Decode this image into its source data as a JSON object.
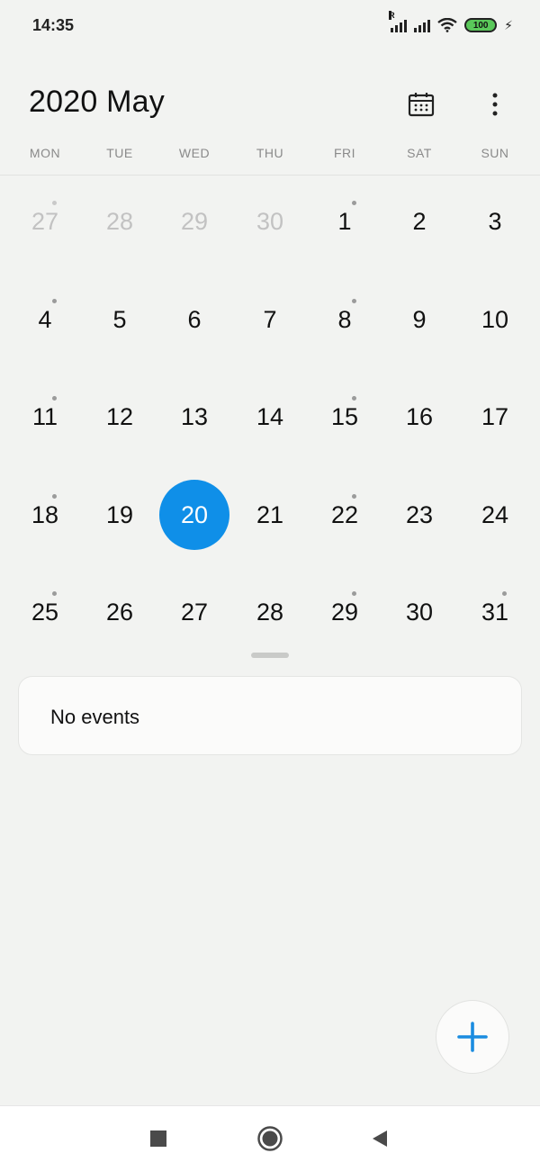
{
  "status_bar": {
    "time": "14:35",
    "battery": "100",
    "icons": [
      "signal-roaming-icon",
      "signal-icon",
      "wifi-icon",
      "battery-icon",
      "charging-icon"
    ]
  },
  "header": {
    "title": "2020 May",
    "calendar_icon": "calendar-icon",
    "more_icon": "more-vertical-icon"
  },
  "weekdays": [
    "MON",
    "TUE",
    "WED",
    "THU",
    "FRI",
    "SAT",
    "SUN"
  ],
  "weeks": [
    [
      {
        "day": "27",
        "muted": true,
        "dot": true
      },
      {
        "day": "28",
        "muted": true,
        "dot": false
      },
      {
        "day": "29",
        "muted": true,
        "dot": false
      },
      {
        "day": "30",
        "muted": true,
        "dot": false
      },
      {
        "day": "1",
        "muted": false,
        "dot": true
      },
      {
        "day": "2",
        "muted": false,
        "dot": false
      },
      {
        "day": "3",
        "muted": false,
        "dot": false
      }
    ],
    [
      {
        "day": "4",
        "muted": false,
        "dot": true
      },
      {
        "day": "5",
        "muted": false,
        "dot": false
      },
      {
        "day": "6",
        "muted": false,
        "dot": false
      },
      {
        "day": "7",
        "muted": false,
        "dot": false
      },
      {
        "day": "8",
        "muted": false,
        "dot": true
      },
      {
        "day": "9",
        "muted": false,
        "dot": false
      },
      {
        "day": "10",
        "muted": false,
        "dot": false
      }
    ],
    [
      {
        "day": "11",
        "muted": false,
        "dot": true
      },
      {
        "day": "12",
        "muted": false,
        "dot": false
      },
      {
        "day": "13",
        "muted": false,
        "dot": false
      },
      {
        "day": "14",
        "muted": false,
        "dot": false
      },
      {
        "day": "15",
        "muted": false,
        "dot": true
      },
      {
        "day": "16",
        "muted": false,
        "dot": false
      },
      {
        "day": "17",
        "muted": false,
        "dot": false
      }
    ],
    [
      {
        "day": "18",
        "muted": false,
        "dot": true
      },
      {
        "day": "19",
        "muted": false,
        "dot": false
      },
      {
        "day": "20",
        "muted": false,
        "dot": false,
        "selected": true
      },
      {
        "day": "21",
        "muted": false,
        "dot": false
      },
      {
        "day": "22",
        "muted": false,
        "dot": true
      },
      {
        "day": "23",
        "muted": false,
        "dot": false
      },
      {
        "day": "24",
        "muted": false,
        "dot": false
      }
    ],
    [
      {
        "day": "25",
        "muted": false,
        "dot": true
      },
      {
        "day": "26",
        "muted": false,
        "dot": false
      },
      {
        "day": "27",
        "muted": false,
        "dot": false
      },
      {
        "day": "28",
        "muted": false,
        "dot": false
      },
      {
        "day": "29",
        "muted": false,
        "dot": true
      },
      {
        "day": "30",
        "muted": false,
        "dot": false
      },
      {
        "day": "31",
        "muted": false,
        "dot": true
      }
    ]
  ],
  "events": {
    "empty_text": "No events"
  },
  "fab": {
    "icon": "plus-icon"
  },
  "navbar": {
    "icons": [
      "recents-square-icon",
      "home-circle-icon",
      "back-triangle-icon"
    ]
  },
  "colors": {
    "accent": "#0f8fe8",
    "background": "#f2f3f1",
    "card": "#fbfbfa"
  }
}
